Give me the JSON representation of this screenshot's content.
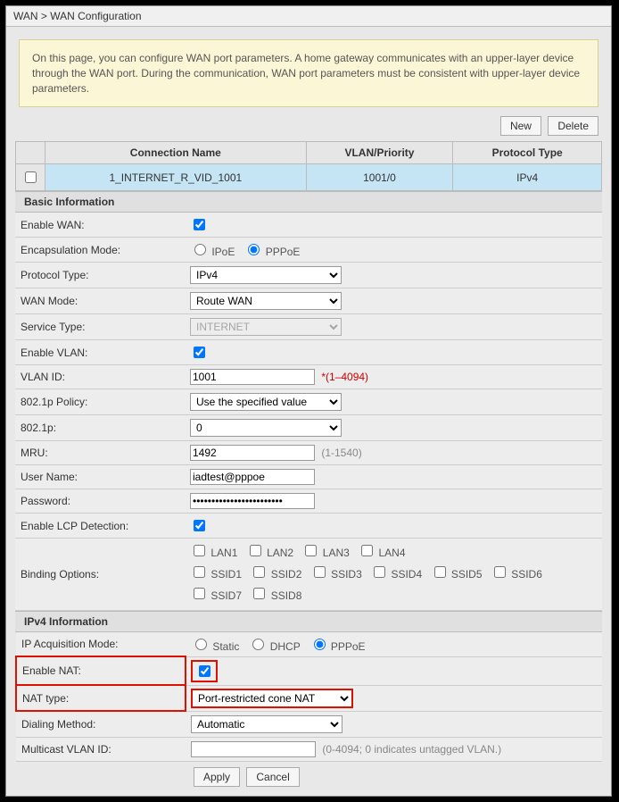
{
  "breadcrumb": "WAN > WAN Configuration",
  "info": "On this page, you can configure WAN port parameters. A home gateway communicates with an upper-layer device through the WAN port. During the communication, WAN port parameters must be consistent with upper-layer device parameters.",
  "actions": {
    "new": "New",
    "delete": "Delete",
    "apply": "Apply",
    "cancel": "Cancel"
  },
  "conn_table": {
    "headers": {
      "name": "Connection Name",
      "vlan": "VLAN/Priority",
      "proto": "Protocol Type"
    },
    "row": {
      "name": "1_INTERNET_R_VID_1001",
      "vlan": "1001/0",
      "proto": "IPv4"
    }
  },
  "sections": {
    "basic": "Basic Information",
    "ipv4": "IPv4 Information"
  },
  "labels": {
    "enable_wan": "Enable WAN:",
    "encap": "Encapsulation Mode:",
    "proto_type": "Protocol Type:",
    "wan_mode": "WAN Mode:",
    "service_type": "Service Type:",
    "enable_vlan": "Enable VLAN:",
    "vlan_id": "VLAN ID:",
    "dot1p_policy": "802.1p Policy:",
    "dot1p": "802.1p:",
    "mru": "MRU:",
    "username": "User Name:",
    "password": "Password:",
    "enable_lcp": "Enable LCP Detection:",
    "binding": "Binding Options:",
    "ip_acq": "IP Acquisition Mode:",
    "enable_nat": "Enable NAT:",
    "nat_type": "NAT type:",
    "dialing": "Dialing Method:",
    "mc_vlan": "Multicast VLAN ID:"
  },
  "values": {
    "encap_ipoe": "IPoE",
    "encap_pppoe": "PPPoE",
    "proto_type": "IPv4",
    "wan_mode": "Route WAN",
    "service_type": "INTERNET",
    "vlan_id": "1001",
    "vlan_hint": "*(1–4094)",
    "dot1p_policy": "Use the specified value",
    "dot1p": "0",
    "mru": "1492",
    "mru_hint": "(1-1540)",
    "username": "iadtest@pppoe",
    "password": "••••••••••••••••••••••••",
    "ip_acq_static": "Static",
    "ip_acq_dhcp": "DHCP",
    "ip_acq_pppoe": "PPPoE",
    "nat_type": "Port-restricted cone NAT",
    "dialing": "Automatic",
    "mc_vlan_placeholder": "(0-4094; 0 indicates untagged VLAN.)"
  },
  "binding": {
    "lan": [
      "LAN1",
      "LAN2",
      "LAN3",
      "LAN4"
    ],
    "ssid": [
      "SSID1",
      "SSID2",
      "SSID3",
      "SSID4",
      "SSID5",
      "SSID6",
      "SSID7",
      "SSID8"
    ]
  }
}
